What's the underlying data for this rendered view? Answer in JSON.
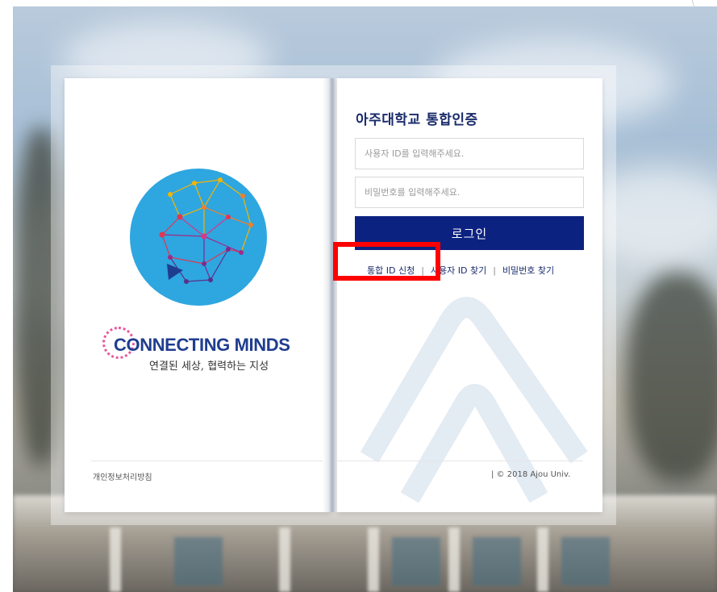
{
  "login": {
    "title": "아주대학교 통합인증",
    "id_placeholder": "사용자 ID를 입력해주세요.",
    "password_placeholder": "비밀번호를 입력해주세요.",
    "login_button": "로그인"
  },
  "links": {
    "register": "통합 ID 신청",
    "find_id": "사용자 ID 찾기",
    "find_password": "비밀번호 찾기",
    "separator": "|"
  },
  "footer": {
    "privacy": "개인정보처리방침",
    "copyright": "|  © 2018 Ajou Univ."
  },
  "branding": {
    "slogan": "CONNECTING MINDS",
    "tagline": "연결된 세상, 협력하는 지성",
    "logo_icon": "ajou-network-globe-icon",
    "watermark_icon": "ajou-emblem-watermark-icon"
  },
  "colors": {
    "primary": "#0c2280",
    "title": "#1a2b6b",
    "logo_circle": "#2ea6e0",
    "highlight": "#ff0000"
  }
}
